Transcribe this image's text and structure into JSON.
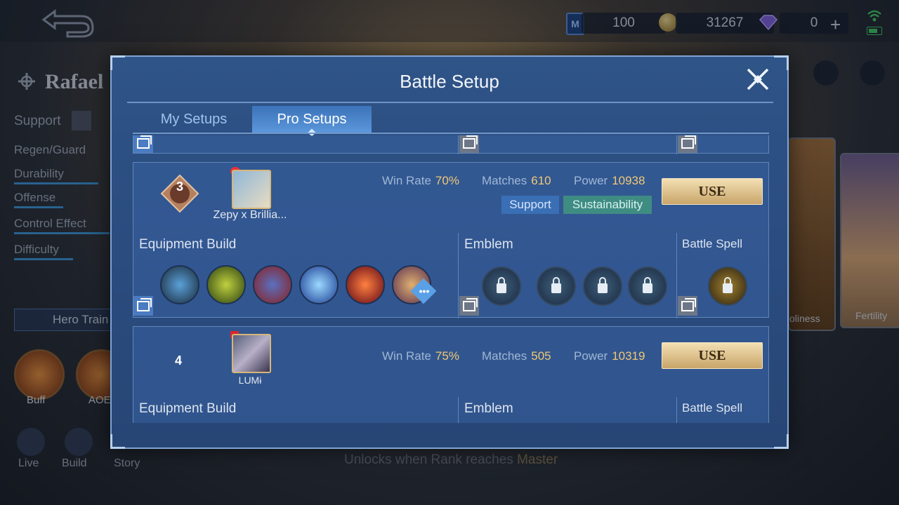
{
  "topbar": {
    "ticket": "100",
    "coins": "31267",
    "diamonds": "0"
  },
  "hero": {
    "name": "Rafael",
    "role": "Support",
    "attrs": [
      "Regen/Guard",
      "Durability",
      "Offense",
      "Control Effect",
      "Difficulty"
    ],
    "train_label": "Hero Train",
    "skills": [
      "Buff",
      "AOE"
    ],
    "bottom": [
      "Live",
      "Build",
      "Story"
    ]
  },
  "unlock_text": {
    "prefix": "Unlocks when Rank reaches",
    "rank": "Master"
  },
  "right_cards": [
    "oliness",
    "Fertility"
  ],
  "modal": {
    "title": "Battle Setup",
    "tabs": [
      "My Setups",
      "Pro Setups"
    ],
    "active_tab": "Pro Setups",
    "use_label": "USE",
    "section_labels": {
      "equipment": "Equipment Build",
      "emblem": "Emblem",
      "spell": "Battle Spell"
    },
    "stat_labels": {
      "win_rate": "Win Rate",
      "matches": "Matches",
      "power": "Power"
    },
    "setups": [
      {
        "rank": "3",
        "player": "Zepy x Brillia...",
        "win_rate": "70%",
        "matches": "610",
        "power": "10938",
        "tags": [
          "Support",
          "Sustainability"
        ],
        "more": "•••"
      },
      {
        "rank": "4",
        "player": "LUMɨ",
        "win_rate": "75%",
        "matches": "505",
        "power": "10319"
      }
    ]
  }
}
